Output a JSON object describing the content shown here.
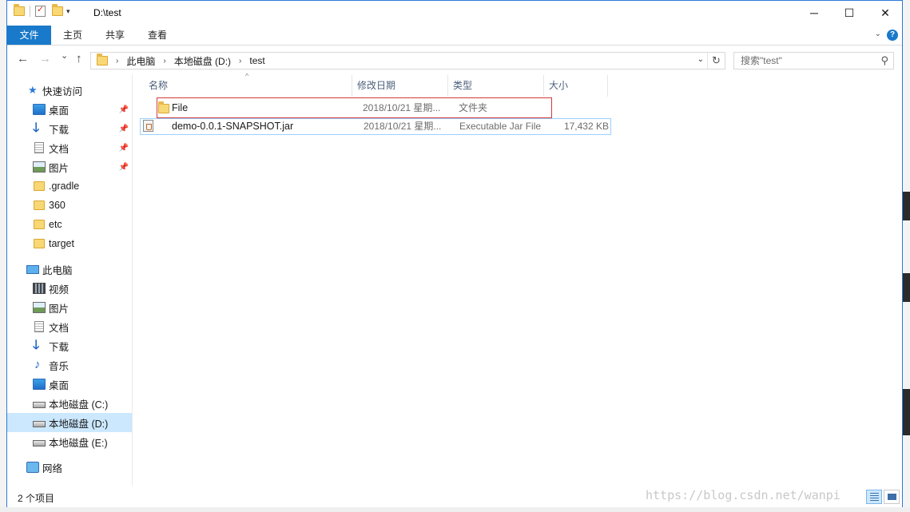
{
  "window": {
    "title": "D:\\test",
    "controls": {
      "minimize": "─",
      "maximize": "☐",
      "close": "✕"
    }
  },
  "quick_access_toolbar": {
    "dropdown": "▾"
  },
  "ribbon": {
    "tabs": [
      {
        "label": "文件"
      },
      {
        "label": "主页"
      },
      {
        "label": "共享"
      },
      {
        "label": "查看"
      }
    ],
    "collapse": "⌄",
    "help": "?"
  },
  "navigation": {
    "back": "←",
    "forward": "→",
    "recent": "⌄",
    "up": "↑",
    "breadcrumbs": [
      "此电脑",
      "本地磁盘 (D:)",
      "test"
    ],
    "separator": "›",
    "address_dropdown": "⌄",
    "refresh": "↻",
    "search_placeholder": "搜索\"test\""
  },
  "sidebar": {
    "quick_access": {
      "label": "快速访问",
      "items": [
        {
          "label": "桌面",
          "icon": "desktop-icon",
          "pinned": true
        },
        {
          "label": "下载",
          "icon": "download-icon",
          "pinned": true
        },
        {
          "label": "文档",
          "icon": "document-icon",
          "pinned": true
        },
        {
          "label": "图片",
          "icon": "picture-icon",
          "pinned": true
        },
        {
          "label": ".gradle",
          "icon": "folder-icon",
          "pinned": false
        },
        {
          "label": "360",
          "icon": "folder-icon",
          "pinned": false
        },
        {
          "label": "etc",
          "icon": "folder-icon",
          "pinned": false
        },
        {
          "label": "target",
          "icon": "folder-icon",
          "pinned": false
        }
      ]
    },
    "this_pc": {
      "label": "此电脑",
      "items": [
        {
          "label": "视频",
          "icon": "video-icon"
        },
        {
          "label": "图片",
          "icon": "picture-icon"
        },
        {
          "label": "文档",
          "icon": "document-icon"
        },
        {
          "label": "下载",
          "icon": "download-icon"
        },
        {
          "label": "音乐",
          "icon": "music-icon"
        },
        {
          "label": "桌面",
          "icon": "desktop-icon"
        },
        {
          "label": "本地磁盘 (C:)",
          "icon": "system-drive-icon"
        },
        {
          "label": "本地磁盘 (D:)",
          "icon": "drive-icon",
          "selected": true
        },
        {
          "label": "本地磁盘 (E:)",
          "icon": "drive-icon"
        }
      ]
    },
    "network": {
      "label": "网络"
    },
    "pin_glyph": "📌"
  },
  "file_list": {
    "columns": [
      "名称",
      "修改日期",
      "类型",
      "大小"
    ],
    "sort_indicator": "^",
    "rows": [
      {
        "name": "File",
        "modified": "2018/10/21 星期...",
        "type": "文件夹",
        "size": "",
        "icon": "folder-icon"
      },
      {
        "name": "demo-0.0.1-SNAPSHOT.jar",
        "modified": "2018/10/21 星期...",
        "type": "Executable Jar File",
        "size": "17,432 KB",
        "icon": "jar-file-icon"
      }
    ]
  },
  "status_bar": {
    "item_count": "2 个项目"
  },
  "watermark": "https://blog.csdn.net/wanpi",
  "colors": {
    "accent": "#1979ca",
    "selection": "#cce8ff",
    "highlight_box": "#d23a3a",
    "header_text": "#4c607a"
  }
}
